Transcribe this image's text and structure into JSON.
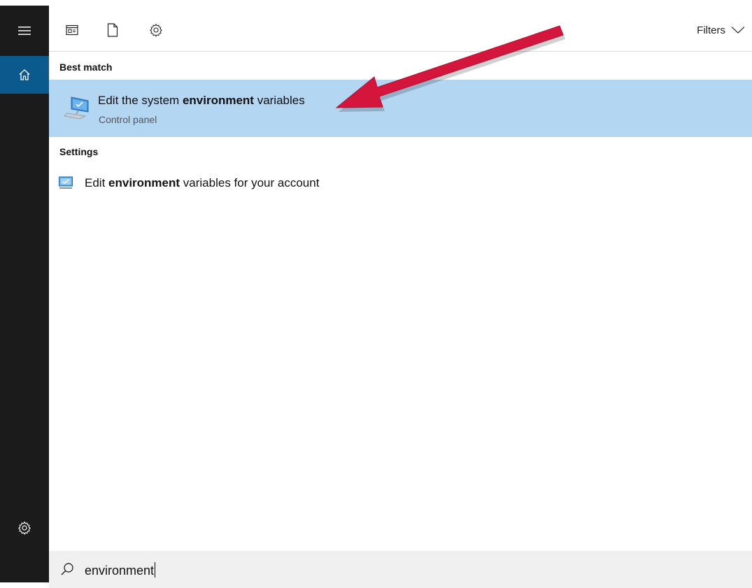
{
  "toolbar": {
    "filters_label": "Filters",
    "icons": [
      "apps-icon",
      "document-icon",
      "gear-icon",
      "chevron-down-icon"
    ]
  },
  "rail": {
    "icons": [
      "hamburger-menu-icon",
      "home-icon",
      "settings-gear-icon"
    ]
  },
  "best_match": {
    "heading": "Best match",
    "result": {
      "title_prefix": "Edit the system ",
      "title_bold": "environment",
      "title_suffix": " variables",
      "subtitle": "Control panel",
      "icon": "system-monitor-icon"
    }
  },
  "settings": {
    "heading": "Settings",
    "result": {
      "title_prefix": "Edit ",
      "title_bold": "environment",
      "title_suffix": " variables for your account",
      "icon": "monitor-settings-icon"
    }
  },
  "search": {
    "value": "environment",
    "icon": "search-icon"
  },
  "annotation": {
    "arrow_color": "#d4163c"
  },
  "colors": {
    "rail_bg": "#1b1b1b",
    "rail_active": "#0b5a8e",
    "selected_bg": "#b3d6f3",
    "search_bg": "#f0f0f0"
  }
}
